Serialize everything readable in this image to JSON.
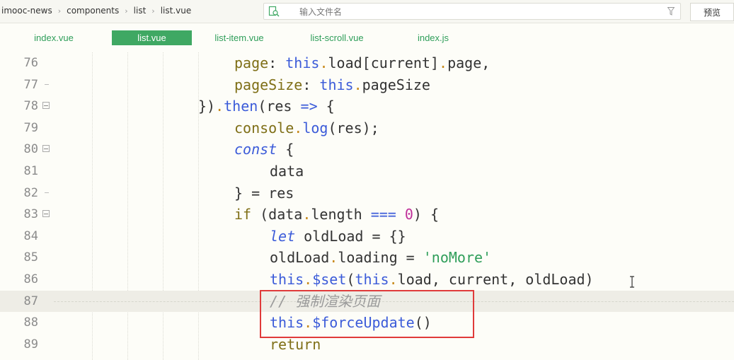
{
  "breadcrumb": [
    "imooc-news",
    "components",
    "list",
    "list.vue"
  ],
  "search": {
    "placeholder": "输入文件名"
  },
  "preview_label": "预览",
  "tabs": [
    {
      "label": "index.vue",
      "active": false
    },
    {
      "label": "list.vue",
      "active": true
    },
    {
      "label": "list-item.vue",
      "active": false
    },
    {
      "label": "list-scroll.vue",
      "active": false
    },
    {
      "label": "index.js",
      "active": false
    }
  ],
  "lines": [
    {
      "num": "76",
      "fold": "",
      "segments": [
        [
          "prop",
          "page"
        ],
        [
          "plain",
          ": "
        ],
        [
          "kw",
          "this"
        ],
        [
          "dot",
          "."
        ],
        [
          "plain",
          "load[current]"
        ],
        [
          "dot",
          "."
        ],
        [
          "plain",
          "page,"
        ]
      ]
    },
    {
      "num": "77",
      "fold": "end",
      "segments": [
        [
          "prop",
          "pageSize"
        ],
        [
          "plain",
          ": "
        ],
        [
          "kw",
          "this"
        ],
        [
          "dot",
          "."
        ],
        [
          "plain",
          "pageSize"
        ]
      ]
    },
    {
      "num": "78",
      "fold": "open",
      "segments": [
        [
          "plain",
          "})"
        ],
        [
          "dot",
          "."
        ],
        [
          "fn",
          "then"
        ],
        [
          "plain",
          "(res "
        ],
        [
          "kw",
          "=>"
        ],
        [
          "plain",
          " {"
        ]
      ]
    },
    {
      "num": "79",
      "fold": "",
      "segments": [
        [
          "prop",
          "console"
        ],
        [
          "dot",
          "."
        ],
        [
          "fn",
          "log"
        ],
        [
          "plain",
          "(res);"
        ]
      ]
    },
    {
      "num": "80",
      "fold": "open",
      "segments": [
        [
          "kwi",
          "const"
        ],
        [
          "plain",
          " {"
        ]
      ]
    },
    {
      "num": "81",
      "fold": "",
      "segments": [
        [
          "plain",
          "data"
        ]
      ]
    },
    {
      "num": "82",
      "fold": "end",
      "segments": [
        [
          "plain",
          "} = res"
        ]
      ]
    },
    {
      "num": "83",
      "fold": "open",
      "segments": [
        [
          "prop",
          "if"
        ],
        [
          "plain",
          " (data"
        ],
        [
          "dot",
          "."
        ],
        [
          "plain",
          "length "
        ],
        [
          "kw",
          "==="
        ],
        [
          "plain",
          " "
        ],
        [
          "num",
          "0"
        ],
        [
          "plain",
          ") {"
        ]
      ]
    },
    {
      "num": "84",
      "fold": "",
      "segments": [
        [
          "kwi",
          "let"
        ],
        [
          "plain",
          " oldLoad = {}"
        ]
      ]
    },
    {
      "num": "85",
      "fold": "",
      "segments": [
        [
          "plain",
          "oldLoad"
        ],
        [
          "dot",
          "."
        ],
        [
          "plain",
          "loading = "
        ],
        [
          "str",
          "'noMore'"
        ]
      ]
    },
    {
      "num": "86",
      "fold": "",
      "segments": [
        [
          "kw",
          "this"
        ],
        [
          "dot",
          "."
        ],
        [
          "fn",
          "$set"
        ],
        [
          "plain",
          "("
        ],
        [
          "kw",
          "this"
        ],
        [
          "dot",
          "."
        ],
        [
          "plain",
          "load, current, oldLoad)"
        ]
      ]
    },
    {
      "num": "87",
      "fold": "",
      "segments": [
        [
          "cmt",
          "// 强制渲染页面"
        ]
      ]
    },
    {
      "num": "88",
      "fold": "",
      "segments": [
        [
          "kw",
          "this"
        ],
        [
          "dot",
          "."
        ],
        [
          "fn",
          "$forceUpdate"
        ],
        [
          "plain",
          "()"
        ]
      ]
    },
    {
      "num": "89",
      "fold": "",
      "segments": [
        [
          "prop",
          "return"
        ]
      ]
    }
  ],
  "colors": {
    "accent": "#3fa863",
    "highlight_box": "#e03a3a"
  }
}
